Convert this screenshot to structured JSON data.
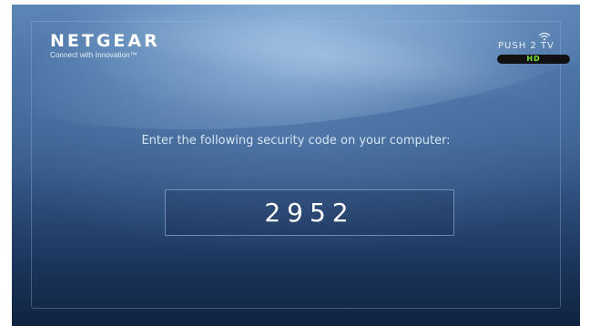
{
  "brand": {
    "name": "NETGEAR",
    "tagline": "Connect with Innovation™"
  },
  "product_logo": {
    "text": "PUSH 2 TV",
    "badge": "HD",
    "icon": "wifi-signal-icon"
  },
  "prompt": "Enter the following security code on your computer:",
  "security_code": "2952",
  "colors": {
    "background_top": "#5c86b6",
    "background_bottom": "#10233f",
    "badge_green": "#7ee83a",
    "text": "#ffffff"
  }
}
